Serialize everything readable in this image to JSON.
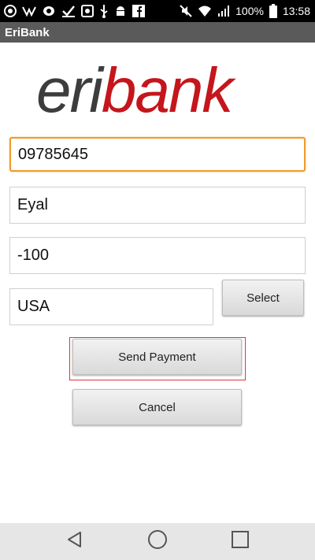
{
  "status_bar": {
    "battery_percent": "100%",
    "time": "13:58",
    "icons": [
      "app-icon",
      "app-icon",
      "app-icon",
      "check-icon",
      "image-icon",
      "usb-icon",
      "android-icon",
      "facebook-icon",
      "mute-icon",
      "wifi-icon",
      "signal-icon",
      "battery-icon"
    ]
  },
  "app": {
    "title": "EriBank"
  },
  "logo": {
    "part1": "eri",
    "part2": "bank",
    "color_dark": "#3d3d3d",
    "color_red": "#c4161c"
  },
  "form": {
    "phone_value": "09785645",
    "name_value": "Eyal",
    "amount_value": "-100",
    "country_value": "USA",
    "select_label": "Select",
    "send_label": "Send Payment",
    "cancel_label": "Cancel"
  },
  "nav": {
    "icons": [
      "back-icon",
      "home-icon",
      "recents-icon"
    ]
  },
  "colors": {
    "focus": "#f09a2f",
    "title_bar": "#5a5a5a",
    "highlight": "#e0353a"
  }
}
